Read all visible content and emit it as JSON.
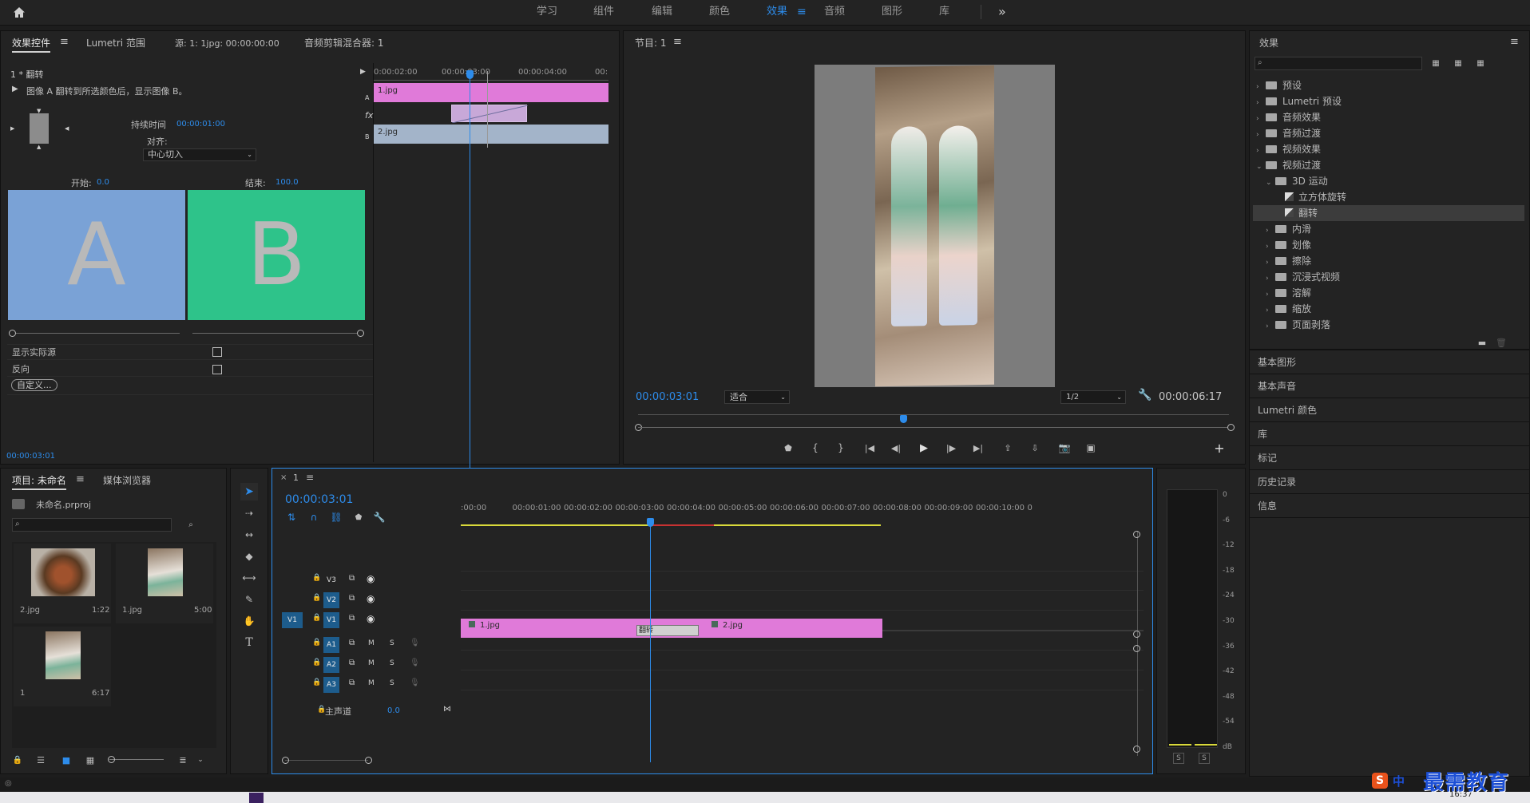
{
  "topbar": {
    "workspaces": [
      "学习",
      "组件",
      "编辑",
      "颜色",
      "效果",
      "音频",
      "图形",
      "库"
    ],
    "active_workspace": "效果",
    "more_label": "»"
  },
  "effect_controls": {
    "tabs": [
      "效果控件",
      "Lumetri 范围",
      "源: 1: 1jpg: 00:00:00:00",
      "音频剪辑混合器: 1"
    ],
    "clip_label": "1 * 翻转",
    "description": "图像 A 翻转到所选颜色后，显示图像 B。",
    "duration_label": "持续时间",
    "duration_value": "00:00:01:00",
    "align_label": "对齐:",
    "align_value": "中心切入",
    "start_label": "开始:",
    "start_value": "0.0",
    "end_label": "结束:",
    "end_value": "100.0",
    "preview_a": "A",
    "preview_b": "B",
    "show_source_label": "显示实际源",
    "reverse_label": "反向",
    "custom_button": "自定义...",
    "timecode": "00:00:03:01",
    "mini_ruler": [
      "0:00:02:00",
      "00:00:03:00",
      "00:00:04:00",
      "00:"
    ],
    "track_a_label": "A",
    "track_b_label": "B",
    "fx_label": "fx",
    "clip_a": "1.jpg",
    "clip_b": "2.jpg"
  },
  "program_monitor": {
    "title": "节目: 1",
    "timecode": "00:00:03:01",
    "fit": "适合",
    "quality": "1/2",
    "duration": "00:00:06:17"
  },
  "effects_panel": {
    "title": "效果",
    "search_placeholder": "",
    "items": [
      {
        "label": "预设",
        "level": 0,
        "expanded": false
      },
      {
        "label": "Lumetri 预设",
        "level": 0,
        "expanded": false
      },
      {
        "label": "音频效果",
        "level": 0,
        "expanded": false
      },
      {
        "label": "音频过渡",
        "level": 0,
        "expanded": false
      },
      {
        "label": "视频效果",
        "level": 0,
        "expanded": false
      },
      {
        "label": "视频过渡",
        "level": 0,
        "expanded": true
      },
      {
        "label": "3D 运动",
        "level": 1,
        "expanded": true
      },
      {
        "label": "立方体旋转",
        "level": 2,
        "expanded": false
      },
      {
        "label": "翻转",
        "level": 2,
        "expanded": false,
        "selected": true
      },
      {
        "label": "内滑",
        "level": 1,
        "expanded": false
      },
      {
        "label": "划像",
        "level": 1,
        "expanded": false
      },
      {
        "label": "擦除",
        "level": 1,
        "expanded": false
      },
      {
        "label": "沉浸式视频",
        "level": 1,
        "expanded": false
      },
      {
        "label": "溶解",
        "level": 1,
        "expanded": false
      },
      {
        "label": "缩放",
        "level": 1,
        "expanded": false
      },
      {
        "label": "页面剥落",
        "level": 1,
        "expanded": false
      }
    ],
    "sections": [
      "基本图形",
      "基本声音",
      "Lumetri 颜色",
      "库",
      "标记",
      "历史记录",
      "信息"
    ]
  },
  "project_panel": {
    "tabs": [
      "项目: 未命名",
      "媒体浏览器"
    ],
    "project_file": "未命名.prproj",
    "items": [
      {
        "name": "2.jpg",
        "duration": "1:22"
      },
      {
        "name": "1.jpg",
        "duration": "5:00"
      },
      {
        "name": "1",
        "duration": "6:17"
      }
    ]
  },
  "timeline": {
    "tab_label": "1",
    "timecode": "00:00:03:01",
    "ruler": [
      ":00:00",
      "00:00:01:00",
      "00:00:02:00",
      "00:00:03:00",
      "00:00:04:00",
      "00:00:05:00",
      "00:00:06:00",
      "00:00:07:00",
      "00:00:08:00",
      "00:00:09:00",
      "00:00:10:00",
      "0"
    ],
    "video_tracks": [
      "V3",
      "V2",
      "V1"
    ],
    "audio_tracks": [
      "A1",
      "A2",
      "A3"
    ],
    "source_patch": "V1",
    "master_label": "主声道",
    "master_value": "0.0",
    "mute": "M",
    "solo": "S",
    "clip1": "1.jpg",
    "clip2": "2.jpg",
    "transition": "翻转"
  },
  "audio_meter": {
    "scale": [
      "0",
      "-6",
      "-12",
      "-18",
      "-24",
      "-30",
      "-36",
      "-42",
      "-48",
      "-54",
      "dB"
    ],
    "solo_l": "S",
    "solo_r": "S"
  },
  "watermark": {
    "text": "最需教育",
    "ime": "中",
    "s": "S"
  },
  "taskbar": {
    "time": "16:37"
  },
  "colors": {
    "accent": "#2d8ceb",
    "clip_pink": "#e07ad9",
    "clip_blue": "#a3b4c9",
    "preview_a": "#7aa2d6",
    "preview_b": "#2ec38a",
    "work_area": "#d9d93a"
  }
}
